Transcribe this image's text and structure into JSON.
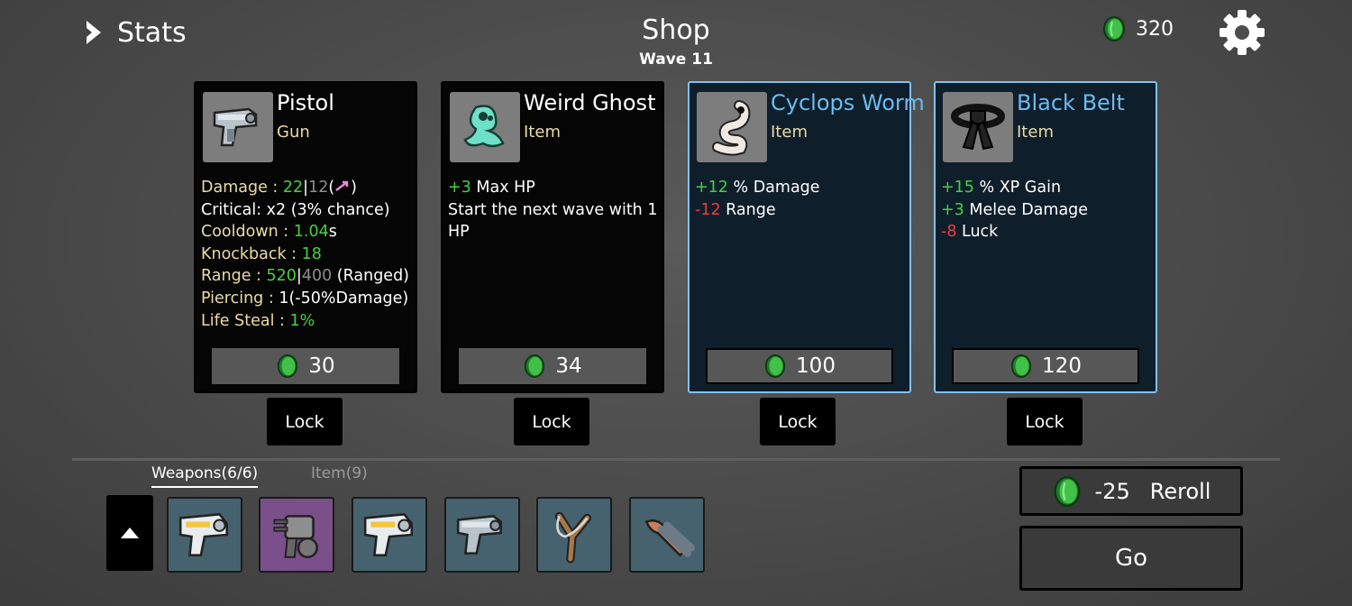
{
  "header": {
    "stats_label": "Stats",
    "title": "Shop",
    "wave": "Wave 11",
    "coins": "320"
  },
  "cards": [
    {
      "name": "Pistol",
      "type": "Gun",
      "icon": "pistol-icon",
      "rarity": "common",
      "stats": {
        "damage_key": "Damage : ",
        "damage_val": "22",
        "damage_base": "12",
        "damage_suffix": ")",
        "critical": "Critical: x2 (3% chance)",
        "cooldown_key": "Cooldown : ",
        "cooldown_val": "1.04",
        "cooldown_unit": "s",
        "knockback_key": "Knockback : ",
        "knockback_val": "18",
        "range_key": "Range : ",
        "range_val": "520",
        "range_base": "400",
        "range_suffix": " (Ranged)",
        "piercing_key": "Piercing : ",
        "piercing_val": "1(-50%Damage)",
        "lifesteal_key": "Life Steal : ",
        "lifesteal_val": "1%"
      },
      "price": "30",
      "lock_label": "Lock"
    },
    {
      "name": "Weird Ghost",
      "type": "Item",
      "icon": "ghost-icon",
      "rarity": "common",
      "effects": [
        {
          "val": "+3",
          "text": " Max HP",
          "color": "green"
        },
        {
          "val": "",
          "text": "Start the next wave with 1 HP",
          "color": "white"
        }
      ],
      "price": "34",
      "lock_label": "Lock"
    },
    {
      "name": "Cyclops Worm",
      "type": "Item",
      "icon": "worm-icon",
      "rarity": "rare",
      "effects": [
        {
          "val": "+12",
          "text": " % Damage",
          "color": "green"
        },
        {
          "val": "-12",
          "text": " Range",
          "color": "red"
        }
      ],
      "price": "100",
      "lock_label": "Lock"
    },
    {
      "name": "Black Belt",
      "type": "Item",
      "icon": "belt-icon",
      "rarity": "rare",
      "effects": [
        {
          "val": "+15",
          "text": " % XP Gain",
          "color": "green"
        },
        {
          "val": "+3",
          "text": " Melee Damage",
          "color": "green"
        },
        {
          "val": "-8",
          "text": " Luck",
          "color": "red"
        }
      ],
      "price": "120",
      "lock_label": "Lock"
    }
  ],
  "inventory": {
    "tabs": [
      "Weapons(6/6)",
      "Item(9)"
    ],
    "weapons": [
      "laser-gun-icon",
      "minigun-icon",
      "laser-gun-icon",
      "pistol-icon",
      "slingshot-icon",
      "shotgun-icon"
    ]
  },
  "actions": {
    "reroll_cost": "-25",
    "reroll_label": "Reroll",
    "go_label": "Go"
  },
  "colors": {
    "positive": "#44d13e",
    "negative": "#f03c3c",
    "stat_key": "#eadba6",
    "rare_border": "#7ec2ec",
    "rare_name": "#6bbbf0"
  }
}
